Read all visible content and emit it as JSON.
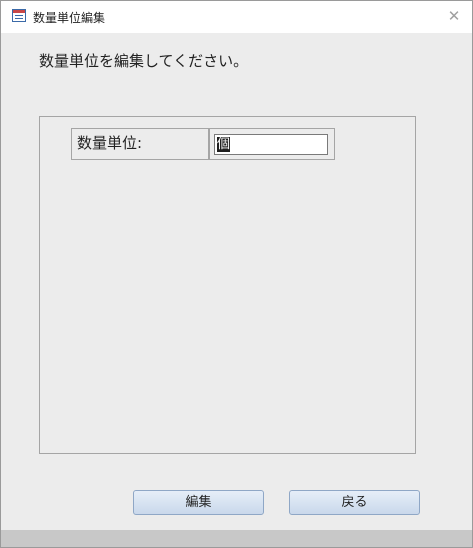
{
  "window": {
    "title": "数量単位編集"
  },
  "instruction": "数量単位を編集してください。",
  "form": {
    "field_label": "数量単位:",
    "field_value": "個"
  },
  "buttons": {
    "edit": "編集",
    "back": "戻る"
  },
  "icons": {
    "title_icon": "form-icon",
    "close_icon": "close-icon"
  },
  "colors": {
    "button_border": "#8fa7c6",
    "background": "#ececec"
  }
}
